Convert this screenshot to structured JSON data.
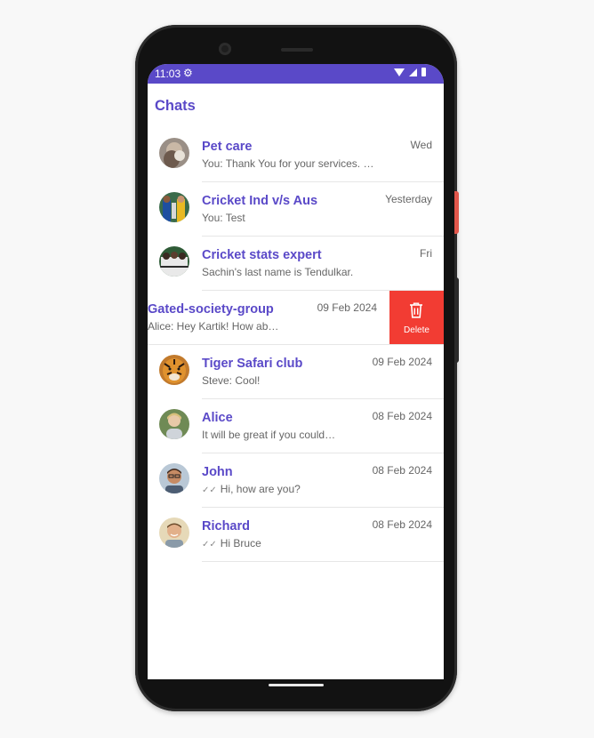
{
  "status_bar": {
    "time": "11:03",
    "settings_icon": "gear-icon",
    "wifi_icon": "wifi-icon",
    "signal_icon": "signal-icon",
    "battery_icon": "battery-icon"
  },
  "header": {
    "title": "Chats"
  },
  "colors": {
    "accent": "#5a49c8",
    "delete": "#f23c33",
    "text_secondary": "#666666"
  },
  "chats": [
    {
      "name": "Pet care",
      "preview": "You: Thank You for your services. …",
      "date": "Wed",
      "avatar": "pet-care-avatar",
      "ticks": false
    },
    {
      "name": "Cricket Ind v/s Aus",
      "preview": "You: Test",
      "date": "Yesterday",
      "avatar": "cricket-avatar",
      "ticks": false
    },
    {
      "name": "Cricket stats expert",
      "preview": "Sachin's last name is Tendulkar.",
      "date": "Fri",
      "avatar": "cricket-stats-avatar",
      "ticks": false
    },
    {
      "name": "Gated-society-group",
      "preview": "Alice: Hey Kartik! How ab…",
      "date": "09 Feb 2024",
      "swiped": true,
      "ticks": false
    },
    {
      "name": "Tiger Safari club",
      "preview": "Steve: Cool!",
      "date": "09 Feb 2024",
      "avatar": "tiger-avatar",
      "ticks": false
    },
    {
      "name": "Alice",
      "preview": "It will be great if you could…",
      "date": "08 Feb 2024",
      "avatar": "alice-avatar",
      "ticks": false
    },
    {
      "name": "John",
      "preview": "Hi, how are you?",
      "date": "08 Feb 2024",
      "avatar": "john-avatar",
      "ticks": true
    },
    {
      "name": "Richard",
      "preview": "Hi Bruce",
      "date": "08 Feb 2024",
      "avatar": "richard-avatar",
      "ticks": true
    }
  ],
  "swipe_action": {
    "label": "Delete",
    "icon": "trash-icon"
  }
}
